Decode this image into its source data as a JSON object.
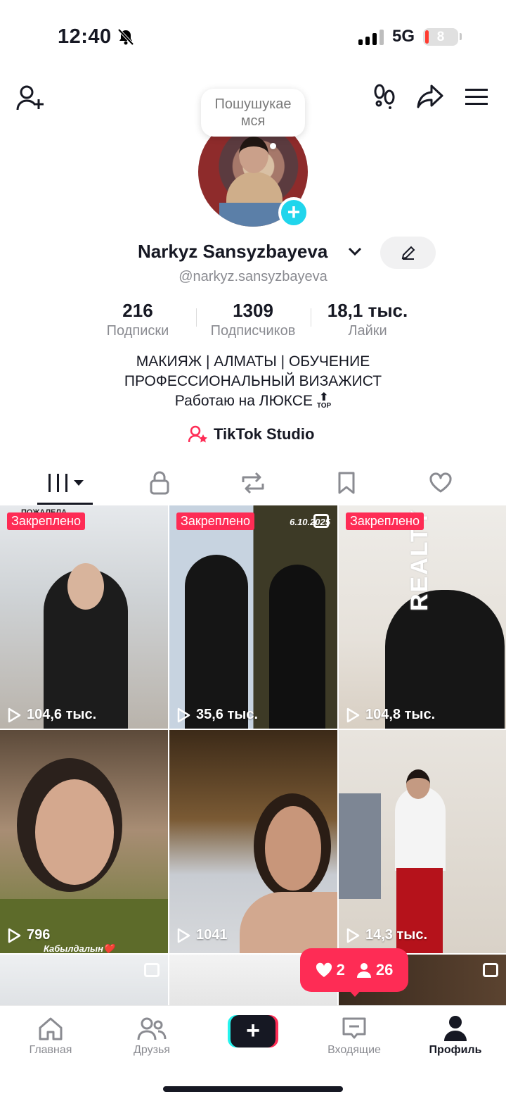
{
  "status_bar": {
    "time": "12:40",
    "network": "5G",
    "battery": "8"
  },
  "profile": {
    "bubble_text": "Пошушукае мся",
    "name": "Narkyz Sansyzbayeva",
    "handle": "@narkyz.sansyzbayeva",
    "stats": [
      {
        "value": "216",
        "label": "Подписки"
      },
      {
        "value": "1309",
        "label": "Подписчиков"
      },
      {
        "value": "18,1 тыс.",
        "label": "Лайки"
      }
    ],
    "bio": [
      "МАКИЯЖ | АЛМАТЫ | ОБУЧЕНИЕ",
      "ПРОФЕССИОНАЛЬНЫЙ ВИЗАЖИСТ",
      "Работаю на ЛЮКСЕ"
    ],
    "bio_badge": "TOP",
    "studio_label": "TikTok Studio"
  },
  "videos": [
    {
      "pinned": "Закреплено",
      "views": "104,6 тыс.",
      "overlay": "ПОЖАЛЕЛА...",
      "color_a": "#dfe3e6",
      "color_b": "#2b2b2b"
    },
    {
      "pinned": "Закреплено",
      "views": "35,6 тыс.",
      "overlay": "6.10.2025",
      "color_a": "#c7d3e0",
      "color_b": "#1b1b1b"
    },
    {
      "pinned": "Закреплено",
      "views": "104,8 тыс.",
      "overlay": "REALTY",
      "color_a": "#e9e6e1",
      "color_b": "#1a1a1a"
    },
    {
      "pinned": "",
      "views": "796",
      "overlay": "Кабылдалын❤️",
      "color_a": "#c9a98a",
      "color_b": "#5a6b2d"
    },
    {
      "pinned": "",
      "views": "1041",
      "overlay": "",
      "color_a": "#6a4a2c",
      "color_b": "#c9cdd3"
    },
    {
      "pinned": "",
      "views": "14,3 тыс.",
      "overlay": "",
      "color_a": "#e6e2dc",
      "color_b": "#b5121b"
    }
  ],
  "notification": {
    "likes": "2",
    "followers": "26"
  },
  "bottom_nav": [
    {
      "label": "Главная"
    },
    {
      "label": "Друзья"
    },
    {
      "label": ""
    },
    {
      "label": "Входящие"
    },
    {
      "label": "Профиль"
    }
  ],
  "colors": {
    "accent": "#fe2c55",
    "cyan": "#25f4ee",
    "plus": "#20d5ec"
  }
}
